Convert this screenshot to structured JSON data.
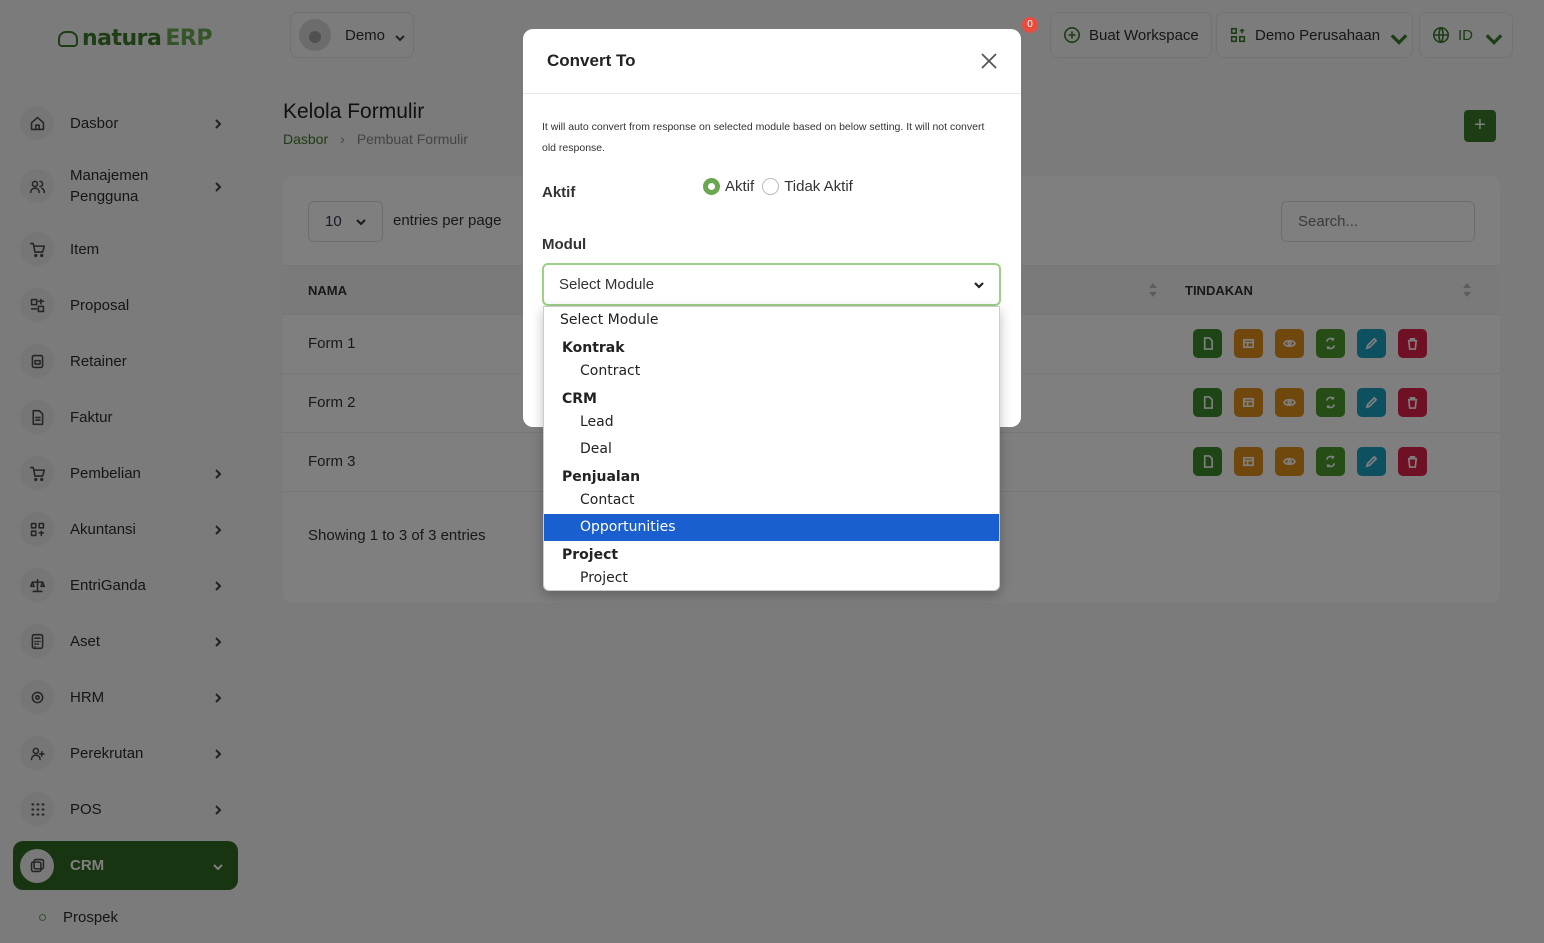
{
  "app": {
    "logo_part1": "natura",
    "logo_part2": "ERP"
  },
  "sidebar": {
    "items": [
      {
        "label": "Dasbor",
        "icon": "home-icon"
      },
      {
        "label": "Manajemen Pengguna",
        "icon": "users-icon"
      },
      {
        "label": "Item",
        "icon": "cart-icon"
      },
      {
        "label": "Proposal",
        "icon": "proposal-icon"
      },
      {
        "label": "Retainer",
        "icon": "retainer-icon"
      },
      {
        "label": "Faktur",
        "icon": "invoice-icon"
      },
      {
        "label": "Pembelian",
        "icon": "cart-icon"
      },
      {
        "label": "Akuntansi",
        "icon": "grid-icon"
      },
      {
        "label": "EntriGanda",
        "icon": "scale-icon"
      },
      {
        "label": "Aset",
        "icon": "calculator-icon"
      },
      {
        "label": "HRM",
        "icon": "hrm-icon"
      },
      {
        "label": "Perekrutan",
        "icon": "user-plus-icon"
      },
      {
        "label": "POS",
        "icon": "dots-grid-icon"
      },
      {
        "label": "CRM",
        "icon": "crm-icon"
      }
    ],
    "sub_item": "Prospek"
  },
  "topbar": {
    "user": "Demo",
    "notif_count": "0",
    "workspace_btn": "Buat Workspace",
    "company": "Demo Perusahaan",
    "lang": "ID"
  },
  "page": {
    "title": "Kelola Formulir",
    "breadcrumb": [
      "Dasbor",
      "Pembuat Formulir"
    ],
    "add_btn": "+"
  },
  "table": {
    "per_page": "10",
    "per_page_label": "entries per page",
    "search_placeholder": "Search...",
    "col_name": "NAMA",
    "col_actions": "TINDAKAN",
    "rows": [
      {
        "name": "Form 1"
      },
      {
        "name": "Form 2"
      },
      {
        "name": "Form 3"
      }
    ],
    "showing": "Showing 1 to 3 of 3 entries",
    "action_colors": [
      "#3a8a2a",
      "#e0901a",
      "#e0901a",
      "#4a9a2a",
      "#1aa0c0",
      "#e0204a"
    ]
  },
  "modal": {
    "title": "Convert To",
    "info": "It will auto convert from response on selected module based on below setting. It will not convert old response.",
    "aktif_label": "Aktif",
    "radio_on": "Aktif",
    "radio_off": "Tidak Aktif",
    "modul_label": "Modul",
    "select_value": "Select Module"
  },
  "dropdown": {
    "placeholder": "Select Module",
    "groups": [
      {
        "label": "Kontrak",
        "options": [
          "Contract"
        ]
      },
      {
        "label": "CRM",
        "options": [
          "Lead",
          "Deal"
        ]
      },
      {
        "label": "Penjualan",
        "options": [
          "Contact",
          "Opportunities"
        ]
      },
      {
        "label": "Project",
        "options": [
          "Project"
        ]
      }
    ],
    "selected": "Opportunities"
  },
  "colors": {
    "accent": "#3a7a2a",
    "selected": "#1a5fcf"
  }
}
